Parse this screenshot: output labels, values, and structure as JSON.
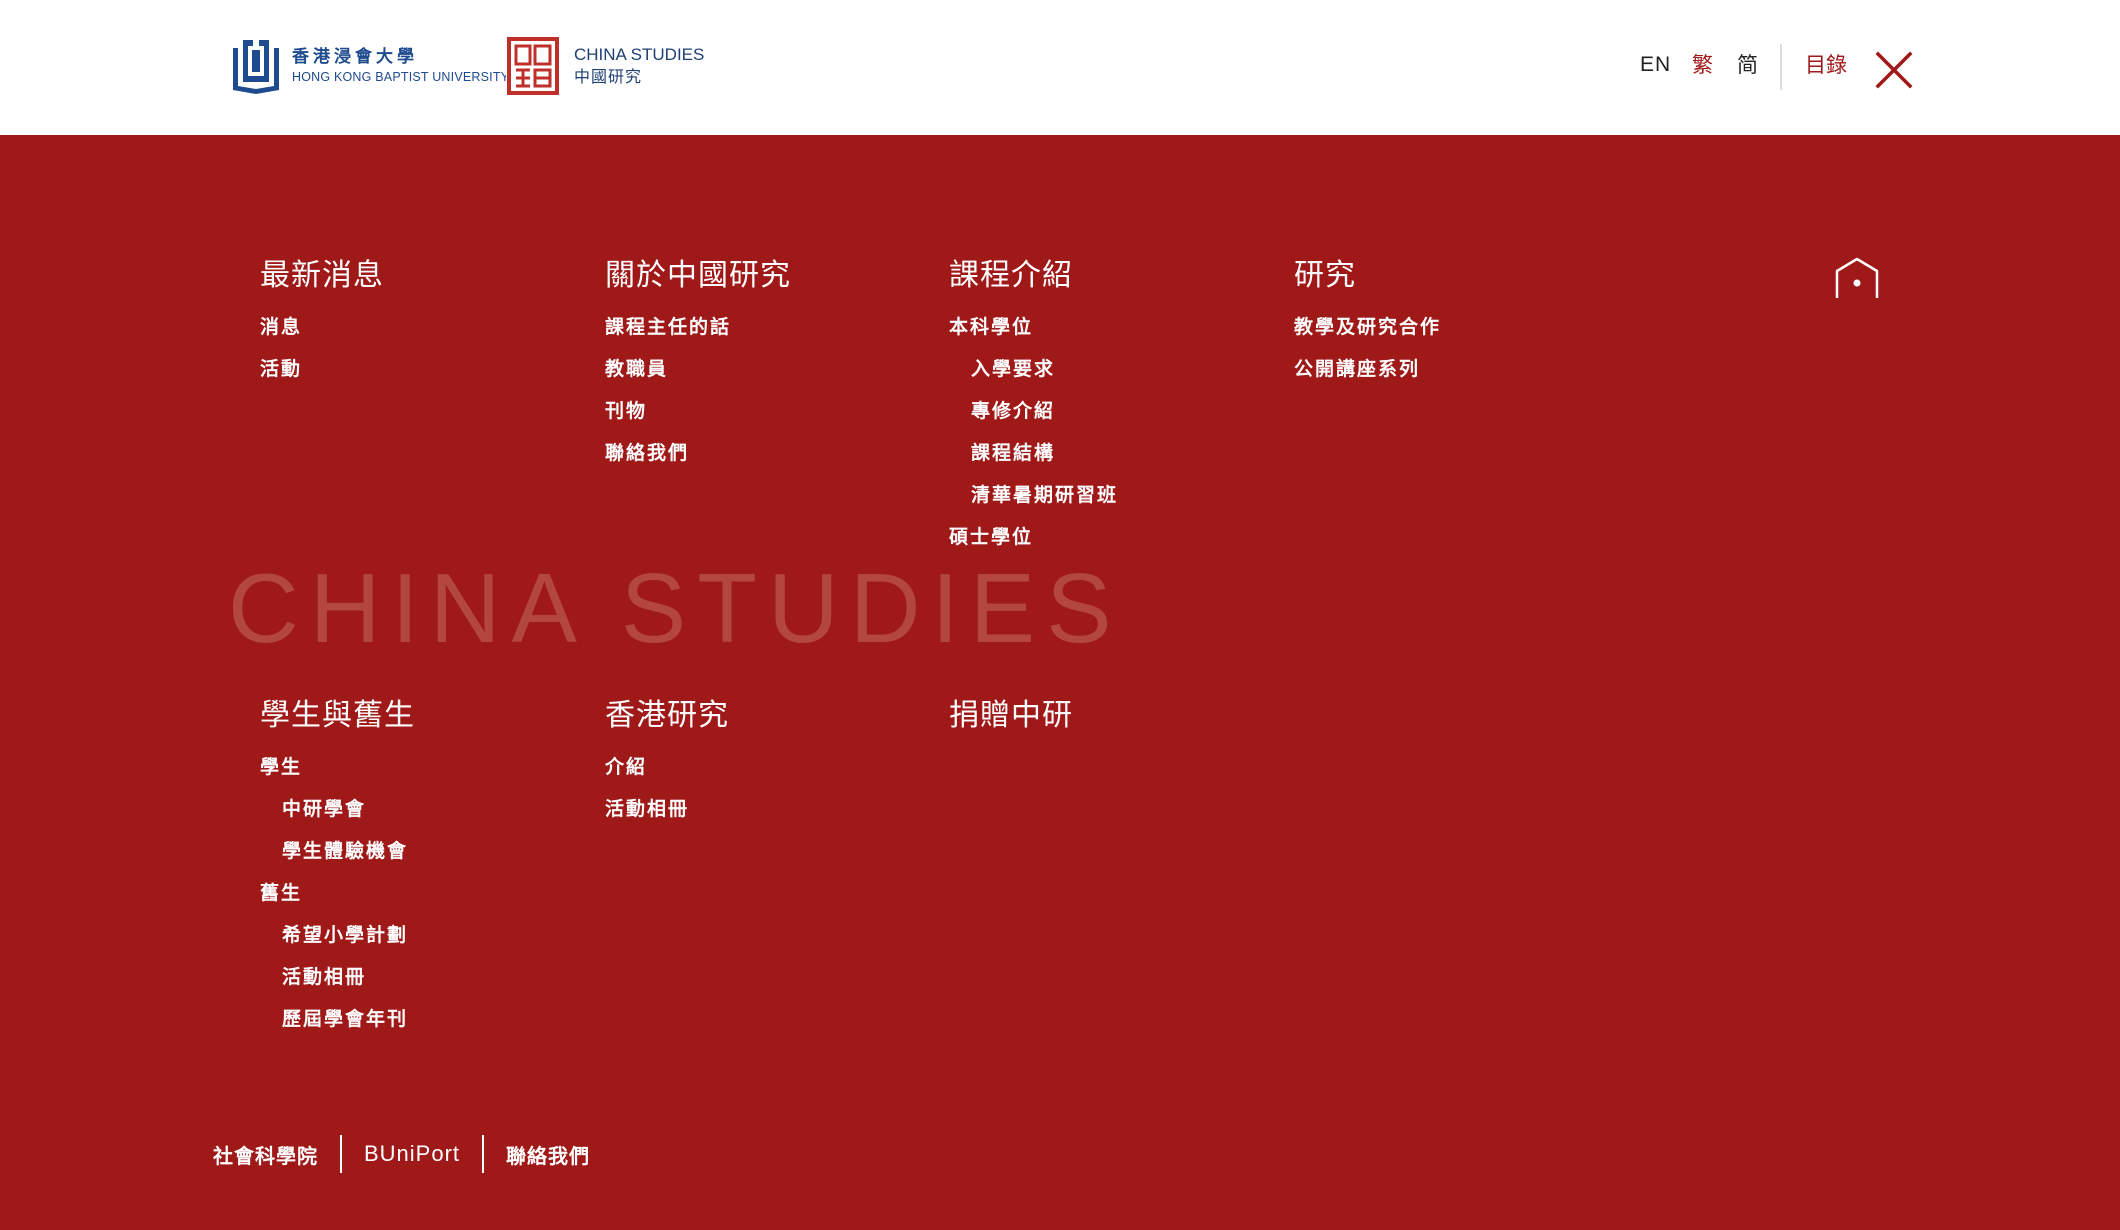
{
  "header": {
    "hkbu_logo": {
      "zh": "香港浸會大學",
      "en": "HONG KONG BAPTIST UNIVERSITY"
    },
    "cs_logo": {
      "en": "CHINA STUDIES",
      "zh": "中國研究"
    },
    "lang": {
      "en": "EN",
      "tc": "繁",
      "sc": "简"
    },
    "menu_label": "目錄"
  },
  "watermark": "CHINA STUDIES",
  "menu": {
    "news": {
      "title": "最新消息",
      "items": [
        "消息",
        "活動"
      ]
    },
    "about": {
      "title": "關於中國研究",
      "items": [
        "課程主任的話",
        "教職員",
        "刊物",
        "聯絡我們"
      ]
    },
    "programmes": {
      "title": "課程介紹",
      "undergrad": "本科學位",
      "undergrad_items": [
        "入學要求",
        "專修介紹",
        "課程結構",
        "清華暑期研習班"
      ],
      "master": "碩士學位"
    },
    "research": {
      "title": "研究",
      "items": [
        "教學及研究合作",
        "公開講座系列"
      ]
    },
    "students": {
      "title": "學生與舊生",
      "students_label": "學生",
      "students_items": [
        "中研學會",
        "學生體驗機會"
      ],
      "alumni_label": "舊生",
      "alumni_items": [
        "希望小學計劃",
        "活動相冊",
        "歷屆學會年刊"
      ]
    },
    "hk_studies": {
      "title": "香港研究",
      "items": [
        "介紹",
        "活動相冊"
      ]
    },
    "donate": {
      "title": "捐贈中研"
    }
  },
  "footer": {
    "links": [
      "社會科學院",
      "BUniPort",
      "聯絡我們"
    ]
  },
  "colors": {
    "brand_red": "#a01919",
    "hkbu_blue": "#1e4b8f",
    "watermark": "#b44640"
  }
}
